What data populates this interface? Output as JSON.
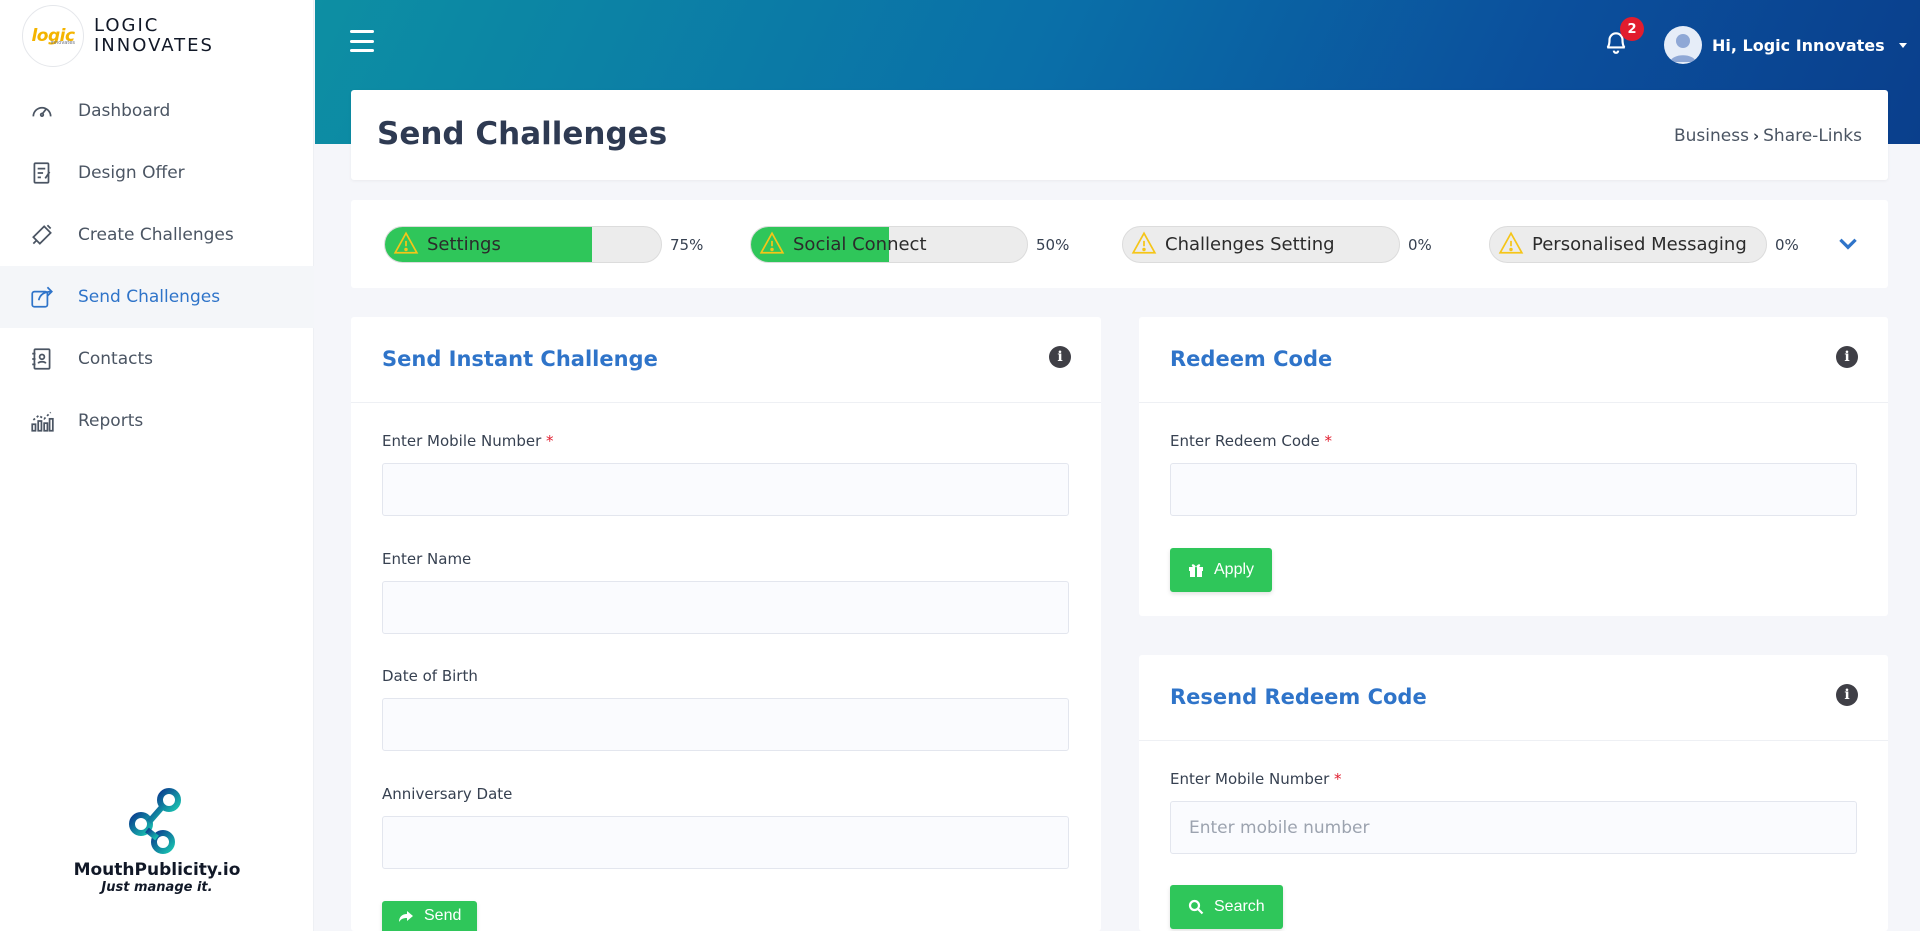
{
  "brand": {
    "logo_word": "logic",
    "logo_sub": "innovates",
    "line1": "LOGIC",
    "line2": "INNOVATES"
  },
  "sidebar": {
    "items": [
      {
        "label": "Dashboard",
        "icon": "gauge-icon"
      },
      {
        "label": "Design Offer",
        "icon": "design-icon"
      },
      {
        "label": "Create Challenges",
        "icon": "megaphone-icon"
      },
      {
        "label": "Send Challenges",
        "icon": "share-icon"
      },
      {
        "label": "Contacts",
        "icon": "contact-book-icon"
      },
      {
        "label": "Reports",
        "icon": "bar-chart-icon"
      }
    ],
    "active": "Send Challenges"
  },
  "footer_brand": {
    "name": "MouthPublicity.io",
    "tagline": "Just manage it."
  },
  "header": {
    "notifications_count": "2",
    "user_greeting": "Hi, Logic Innovates"
  },
  "page": {
    "title": "Send Challenges",
    "breadcrumb": [
      "Business",
      "Share-Links"
    ]
  },
  "progress": [
    {
      "label": "Settings",
      "value": 0.75,
      "pct_text": "75%"
    },
    {
      "label": "Social Connect",
      "value": 0.5,
      "pct_text": "50%"
    },
    {
      "label": "Challenges Setting",
      "value": 0,
      "pct_text": "0%"
    },
    {
      "label": "Personalised Messaging",
      "value": 0,
      "pct_text": "0%"
    }
  ],
  "instant": {
    "title": "Send Instant Challenge",
    "mobile_label": "Enter Mobile Number",
    "name_label": "Enter Name",
    "dob_label": "Date of Birth",
    "anniv_label": "Anniversary Date",
    "send_label": "Send",
    "required_mark": "*"
  },
  "redeem": {
    "title": "Redeem Code",
    "code_label": "Enter Redeem Code",
    "apply_label": "Apply",
    "required_mark": "*"
  },
  "resend": {
    "title": "Resend Redeem Code",
    "mobile_label": "Enter Mobile Number",
    "mobile_placeholder": "Enter mobile number",
    "search_label": "Search",
    "required_mark": "*"
  },
  "colors": {
    "accent": "#2f74c9",
    "success": "#2fc65a",
    "danger": "#e11d2e",
    "warning": "#f5c518"
  }
}
